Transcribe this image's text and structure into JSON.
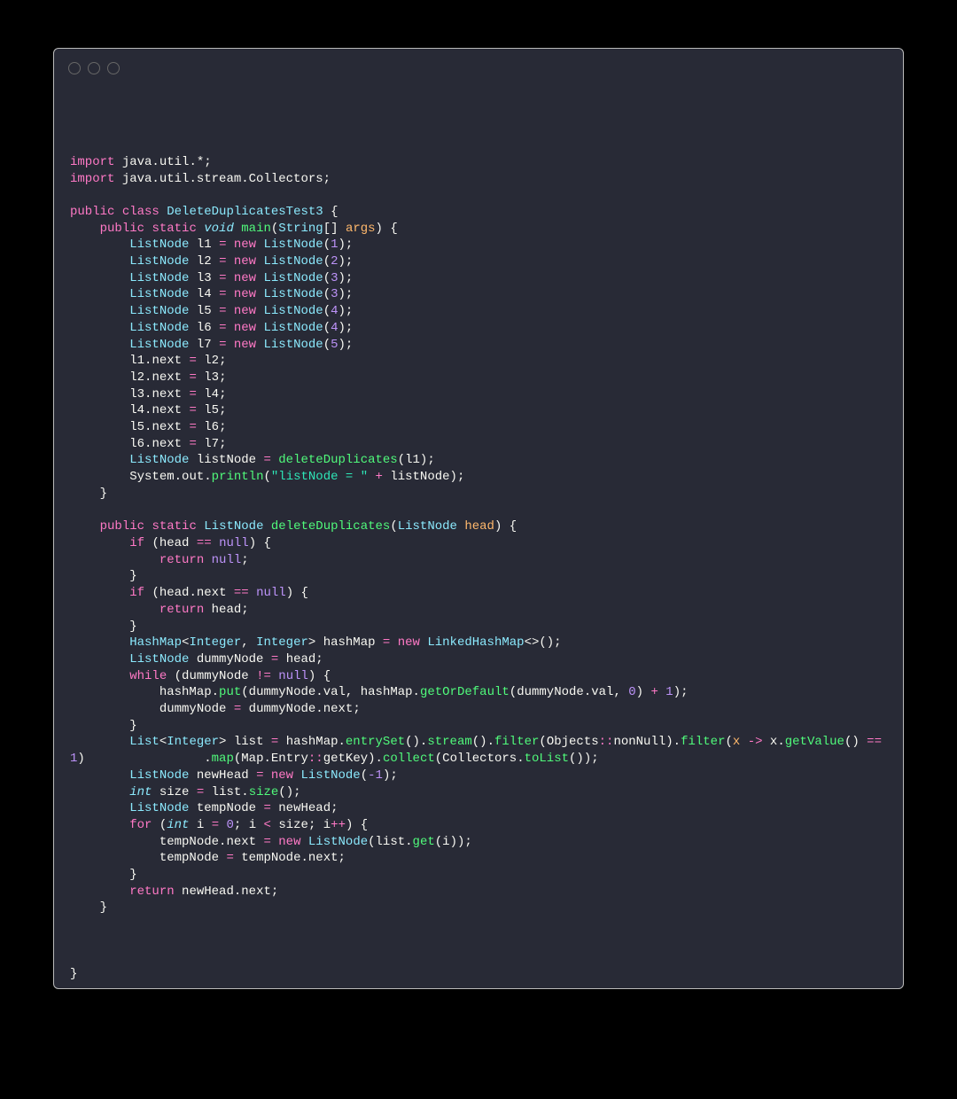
{
  "window": {
    "controls": [
      "close",
      "minimize",
      "zoom"
    ]
  },
  "code": {
    "language": "java",
    "class_name": "DeleteDuplicatesTest3",
    "imports": [
      "java.util.*",
      "java.util.stream.Collectors"
    ],
    "list_nodes": [
      {
        "var": "l1",
        "val": 1
      },
      {
        "var": "l2",
        "val": 2
      },
      {
        "var": "l3",
        "val": 3
      },
      {
        "var": "l4",
        "val": 3
      },
      {
        "var": "l5",
        "val": 4
      },
      {
        "var": "l6",
        "val": 4
      },
      {
        "var": "l7",
        "val": 5
      }
    ],
    "next_chain": [
      [
        "l1",
        "l2"
      ],
      [
        "l2",
        "l3"
      ],
      [
        "l3",
        "l4"
      ],
      [
        "l4",
        "l5"
      ],
      [
        "l5",
        "l6"
      ],
      [
        "l6",
        "l7"
      ]
    ],
    "print_label": "\"listNode = \"",
    "method2_name": "deleteDuplicates",
    "new_head_init": -1,
    "default_count": 0,
    "increment": 1,
    "filter_eq": 1,
    "loop_start": 0
  }
}
